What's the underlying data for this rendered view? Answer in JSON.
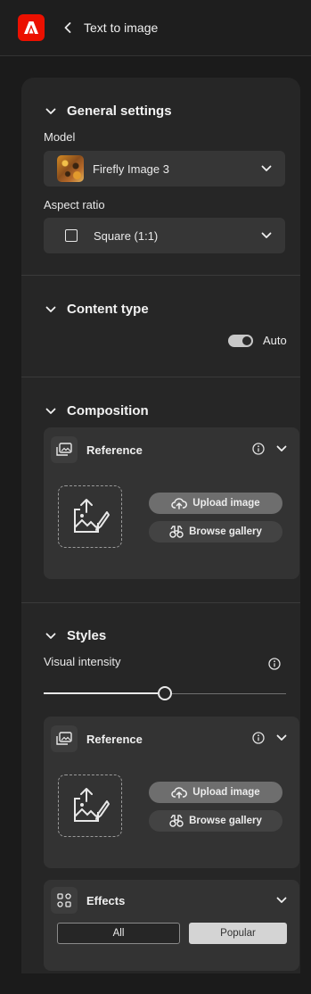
{
  "header": {
    "title": "Text to image"
  },
  "general_settings": {
    "title": "General settings",
    "model_label": "Model",
    "model_value": "Firefly Image 3",
    "aspect_label": "Aspect ratio",
    "aspect_value": "Square (1:1)"
  },
  "content_type": {
    "title": "Content type",
    "toggle_label": "Auto",
    "toggle_on": true
  },
  "composition": {
    "title": "Composition",
    "reference_title": "Reference",
    "upload_label": "Upload image",
    "browse_label": "Browse gallery"
  },
  "styles": {
    "title": "Styles",
    "intensity_label": "Visual intensity",
    "intensity_value": 0.5,
    "reference_title": "Reference",
    "upload_label": "Upload image",
    "browse_label": "Browse gallery",
    "effects_title": "Effects",
    "effects_tabs": [
      "All",
      "Popular"
    ],
    "effects_selected": "Popular"
  },
  "colors": {
    "accent_logo": "#eb1000",
    "panel_bg": "#262626",
    "card_bg": "#333333"
  }
}
